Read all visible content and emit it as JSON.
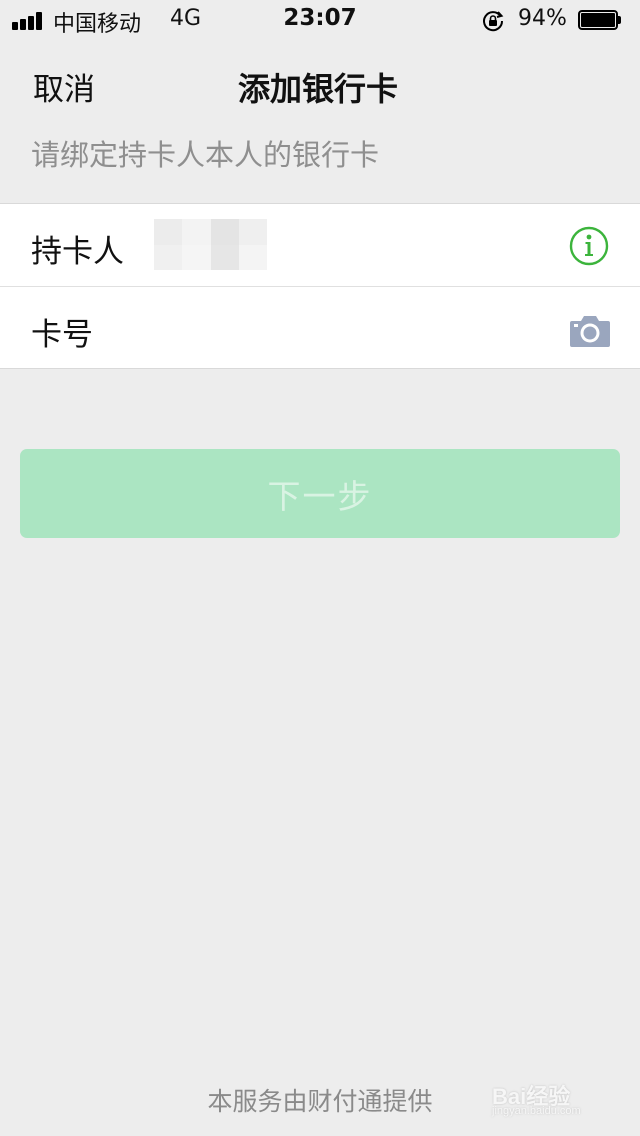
{
  "status_bar": {
    "carrier": "中国移动",
    "network": "4G",
    "time": "23:07",
    "battery_percent": "94%",
    "icons": [
      "signal-icon",
      "orientation-lock-icon",
      "battery-icon"
    ]
  },
  "nav": {
    "cancel_label": "取消",
    "title": "添加银行卡"
  },
  "hint": "请绑定持卡人本人的银行卡",
  "form": {
    "holder_label": "持卡人",
    "holder_value_masked": true,
    "card_label": "卡号",
    "card_placeholder": "",
    "info_icon": "info-icon",
    "camera_icon": "camera-icon"
  },
  "next_button_label": "下一步",
  "footer": "本服务由财付通提供",
  "watermark": {
    "logo": "Bai经验",
    "site": "jingyan.baidu.com"
  },
  "colors": {
    "background": "#ededed",
    "button": "#abe5c2",
    "button_text": "#d9f3e3",
    "info_green": "#3cb43c",
    "camera_gray": "#9aa6be"
  }
}
